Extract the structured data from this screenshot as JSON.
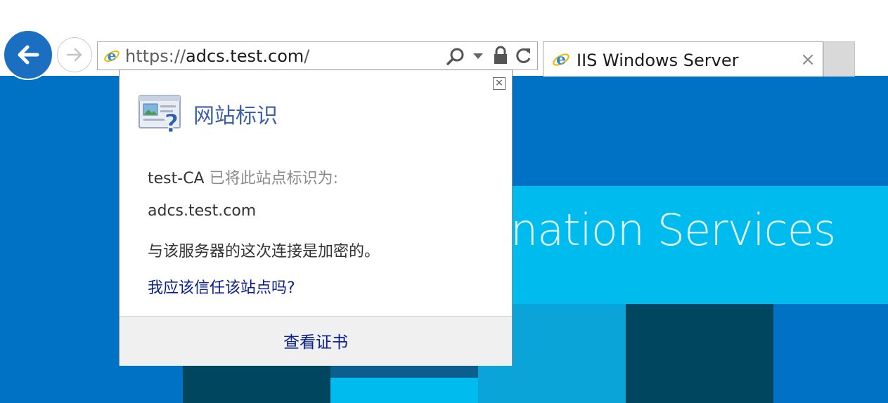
{
  "browser": {
    "address_bar": {
      "url_prefix": "https://",
      "url_host": "adcs.test.com",
      "url_suffix": "/"
    },
    "tab": {
      "title": "IIS Windows Server",
      "close_glyph": "×"
    },
    "icons": {
      "back": "back-arrow-icon",
      "forward": "forward-arrow-icon",
      "page": "ie-logo-icon",
      "search": "search-icon",
      "dropdown": "chevron-down-icon",
      "security": "lock-icon",
      "refresh": "refresh-icon"
    },
    "colors": {
      "back_button": "#1b6fc0"
    }
  },
  "page": {
    "banner_text": "nation Services",
    "colors": {
      "bg": "#0072c6",
      "band": "#00bbee",
      "dark_tile": "#00465f"
    }
  },
  "site_identity_popup": {
    "title": "网站标识",
    "issuer": "test-CA",
    "issuer_suffix": " 已将此站点标识为:",
    "site": "adcs.test.com",
    "encryption_text": "与该服务器的这次连接是加密的。",
    "trust_link": "我应该信任该站点吗?",
    "view_certificate": "查看证书",
    "close_glyph": "×"
  }
}
